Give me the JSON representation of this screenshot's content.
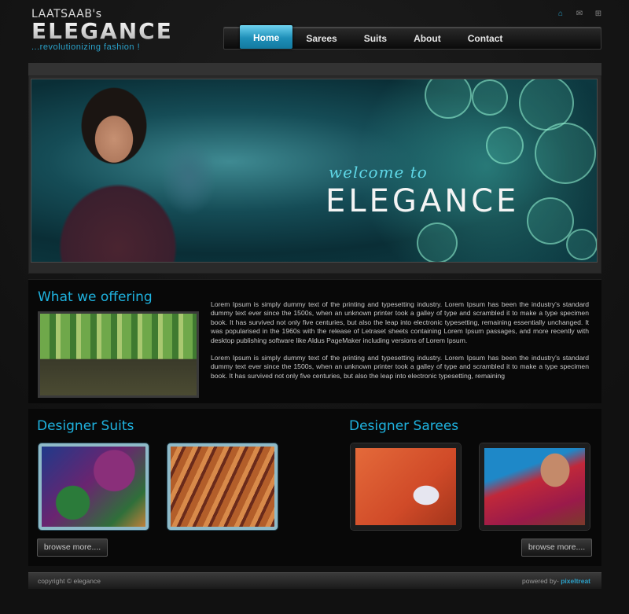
{
  "header": {
    "brand_small": "LAATSAAB's",
    "brand_big": "ELEGANCE",
    "tagline": "...revolutionizing fashion !",
    "icons": [
      "home-icon",
      "mail-icon",
      "sitemap-icon"
    ]
  },
  "nav": {
    "items": [
      {
        "label": "Home",
        "active": true
      },
      {
        "label": "Sarees"
      },
      {
        "label": "Suits"
      },
      {
        "label": "About"
      },
      {
        "label": "Contact"
      }
    ]
  },
  "banner": {
    "welcome": "welcome to",
    "title": "ELEGANCE"
  },
  "offering": {
    "heading": "What we offering",
    "paragraphs": [
      "Lorem Ipsum is simply dummy text of the printing and typesetting industry. Lorem Ipsum has been the industry's standard dummy text ever since the 1500s, when an unknown printer took a galley of type and scrambled it to make a type specimen book. It has survived not only five centuries, but also the leap into electronic typesetting, remaining essentially unchanged. It was popularised in the 1960s with the release of Letraset sheets containing Lorem Ipsum passages, and more recently with desktop publishing software like Aldus PageMaker including versions of Lorem Ipsum.",
      "Lorem Ipsum is simply dummy text of the printing and typesetting industry. Lorem Ipsum has been the industry's standard dummy text ever since the 1500s, when an unknown printer took a galley of type and scrambled it to make a type specimen book. It has survived not only five centuries, but also the leap into electronic typesetting, remaining"
    ]
  },
  "suits": {
    "heading": "Designer Suits",
    "browse_label": "browse more...."
  },
  "sarees": {
    "heading": "Designer Sarees",
    "browse_label": "browse more...."
  },
  "footer": {
    "copyright": "copyright © elegance",
    "powered_prefix": "powered by-",
    "powered_by": "pixeltreat"
  },
  "colors": {
    "accent": "#1fb3e0",
    "nav_active": "#1e8fb8"
  }
}
